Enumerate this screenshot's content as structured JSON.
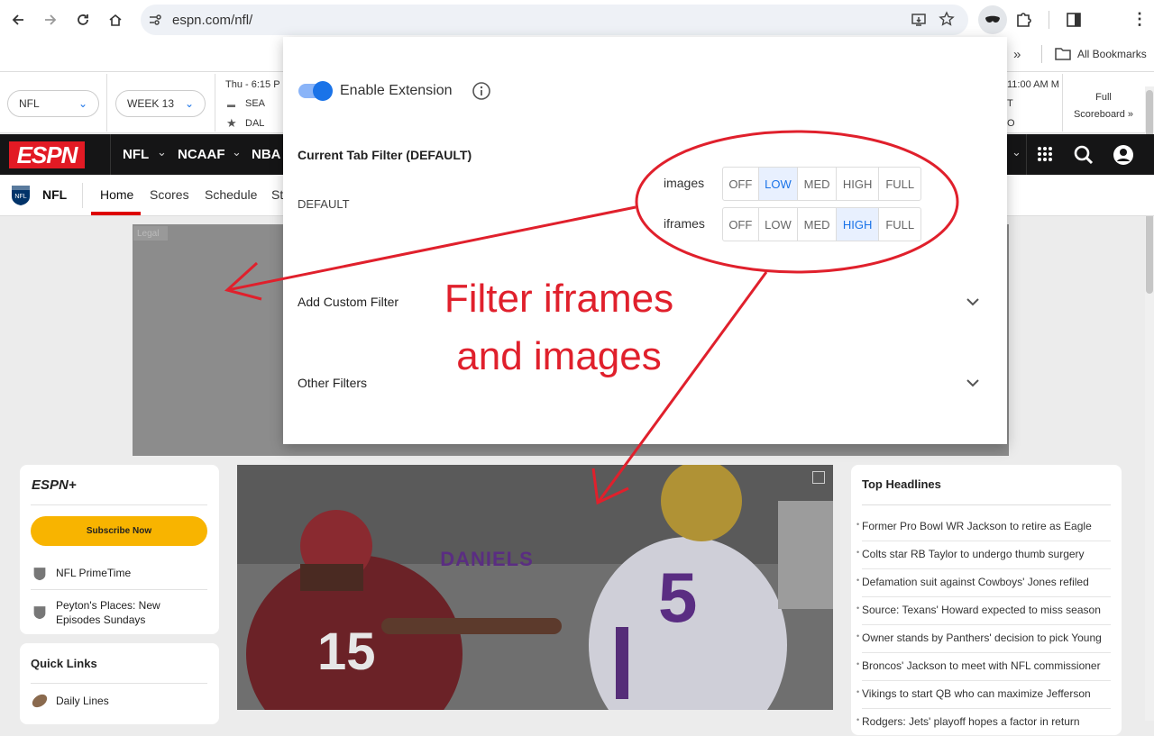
{
  "browser": {
    "url": "espn.com/nfl/",
    "bookmarks_label": "All Bookmarks",
    "icons": [
      "back-icon",
      "forward-icon",
      "reload-icon",
      "home-icon",
      "site-info-icon",
      "install-icon",
      "star-icon",
      "extension-mask-icon",
      "puzzle-icon",
      "sidebar-icon",
      "kebab-menu-icon"
    ]
  },
  "scoreboard": {
    "league_select": "NFL",
    "week_select": "WEEK 13",
    "game_time": "Thu - 6:15 P",
    "team1": "SEA",
    "team2": "DAL",
    "right_time": "11:00 AM M",
    "right_team1": "T",
    "right_team2": "O",
    "full_scoreboard_line1": "Full",
    "full_scoreboard_line2": "Scoreboard »"
  },
  "espn_nav": {
    "logo": "ESPN",
    "items": [
      "NFL",
      "NCAAF",
      "NBA"
    ]
  },
  "subnav": {
    "league": "NFL",
    "items": [
      "Home",
      "Scores",
      "Schedule",
      "St"
    ]
  },
  "ad_label": "Legal",
  "popup": {
    "enable_label": "Enable Extension",
    "current_tab_filter": "Current Tab Filter (DEFAULT)",
    "profile": "DEFAULT",
    "rows": [
      {
        "label": "images",
        "options": [
          "OFF",
          "LOW",
          "MED",
          "HIGH",
          "FULL"
        ],
        "selected": "LOW"
      },
      {
        "label": "iframes",
        "options": [
          "OFF",
          "LOW",
          "MED",
          "HIGH",
          "FULL"
        ],
        "selected": "HIGH"
      }
    ],
    "add_custom_filter": "Add Custom Filter",
    "other_filters": "Other Filters"
  },
  "annotation": {
    "line1": "Filter iframes",
    "line2": "and images",
    "color": "#e0202c"
  },
  "espn_plus": {
    "logo": "ESPN+",
    "subscribe": "Subscribe Now",
    "items": [
      "NFL PrimeTime",
      "Peyton's Places: New Episodes Sundays"
    ]
  },
  "quick_links": {
    "title": "Quick Links",
    "items": [
      "Daily Lines"
    ]
  },
  "hero": {
    "jersey_name": "DANIELS",
    "jersey_number": "5",
    "other_number": "15"
  },
  "top_headlines": {
    "title": "Top Headlines",
    "items": [
      "Former Pro Bowl WR Jackson to retire as Eagle",
      "Colts star RB Taylor to undergo thumb surgery",
      "Defamation suit against Cowboys' Jones refiled",
      "Source: Texans' Howard expected to miss season",
      "Owner stands by Panthers' decision to pick Young",
      "Broncos' Jackson to meet with NFL commissioner",
      "Vikings to start QB who can maximize Jefferson",
      "Rodgers: Jets' playoff hopes a factor in return"
    ]
  }
}
